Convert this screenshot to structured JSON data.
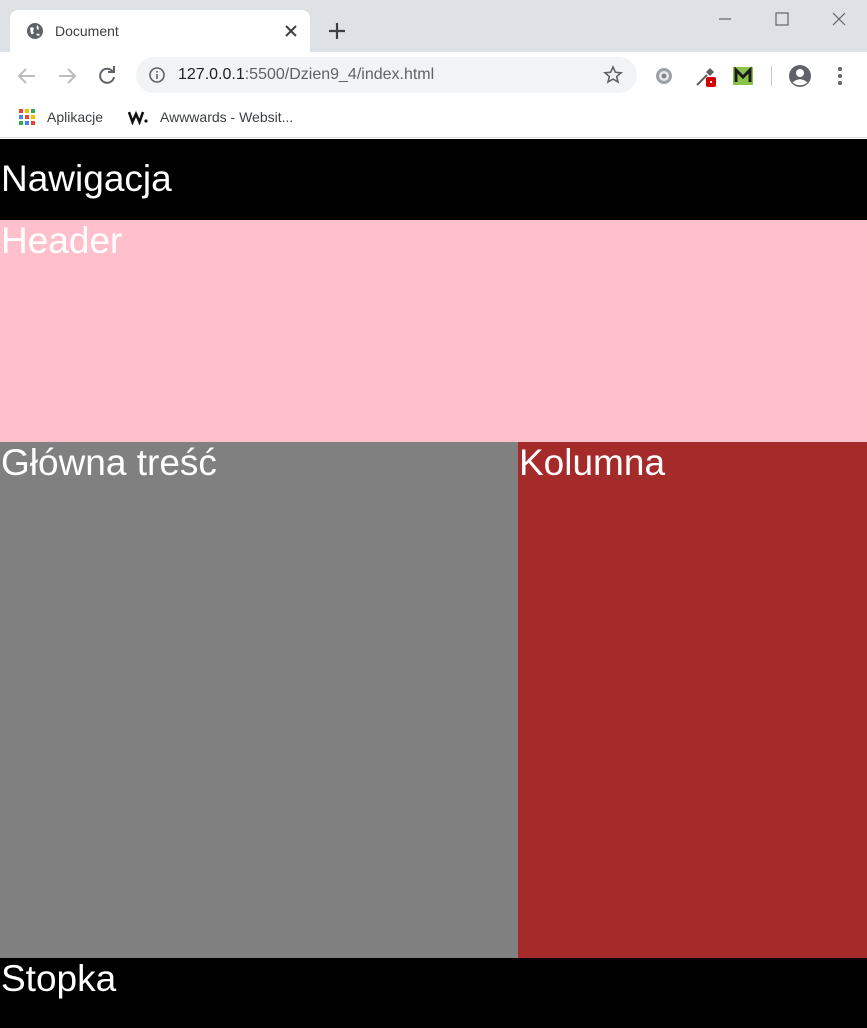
{
  "browser": {
    "tab": {
      "title": "Document"
    },
    "address": {
      "host": "127.0.0.1",
      "path": ":5500/Dzien9_4/index.html"
    },
    "bookmarks": [
      {
        "label": "Aplikacje",
        "icon": "apps-grid-icon"
      },
      {
        "label": "Awwwards - Websit...",
        "icon": "awwwards-w-icon"
      }
    ]
  },
  "page": {
    "nav": "Nawigacja",
    "header": "Header",
    "main": "Główna treść",
    "column": "Kolumna",
    "footer": "Stopka"
  },
  "colors": {
    "nav": "#000000",
    "header": "#ffc0cb",
    "main": "#808080",
    "column": "#a52a2a",
    "footer": "#000000"
  }
}
